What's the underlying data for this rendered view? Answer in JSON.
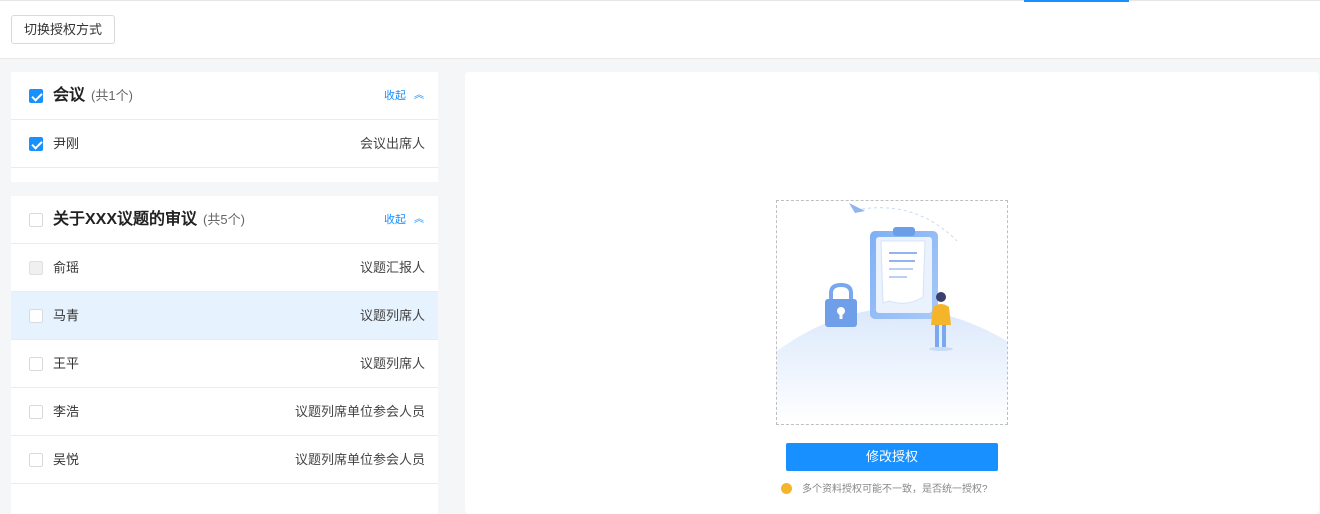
{
  "toolbar": {
    "switch_label": "切换授权方式"
  },
  "groups": [
    {
      "title": "会议",
      "count": "(共1个)",
      "collapse_label": "收起",
      "checked": true,
      "members": [
        {
          "name": "尹刚",
          "role": "会议出席人",
          "checked": true
        }
      ]
    },
    {
      "title": "关于XXX议题的审议",
      "count": "(共5个)",
      "collapse_label": "收起",
      "checked": false,
      "members": [
        {
          "name": "俞瑶",
          "role": "议题汇报人",
          "checked": false,
          "disabled": true
        },
        {
          "name": "马青",
          "role": "议题列席人",
          "checked": false,
          "highlighted": true
        },
        {
          "name": "王平",
          "role": "议题列席人",
          "checked": false
        },
        {
          "name": "李浩",
          "role": "议题列席单位参会人员",
          "checked": false
        },
        {
          "name": "吴悦",
          "role": "议题列席单位参会人员",
          "checked": false
        }
      ]
    }
  ],
  "main": {
    "action_label": "修改授权",
    "hint": "多个资料授权可能不一致，是否统一授权?"
  },
  "colors": {
    "accent": "#1890ff",
    "row_highlight": "#e6f2fd",
    "hint_dot": "#f5b52a"
  },
  "icons": {
    "collapse": "chevron-up-double-icon",
    "illustration": "clipboard-lock-person-illustration"
  }
}
